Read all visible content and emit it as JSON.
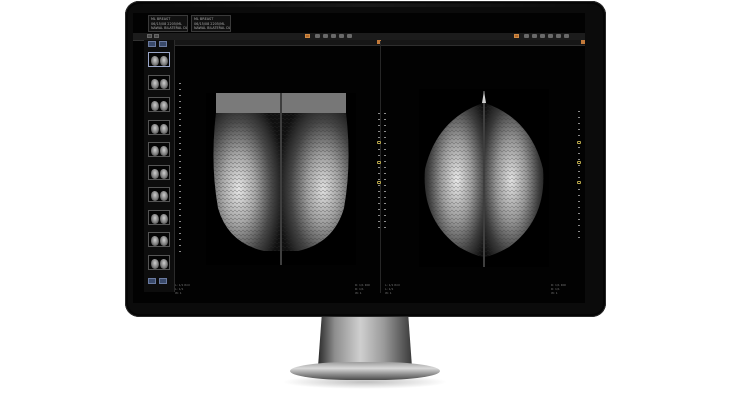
{
  "patient_info": {
    "left_box": [
      "ML BREAST",
      "06/15/08 2205/ML",
      "NAWAL BILATERAL DL"
    ],
    "right_box": [
      "ML BREAST",
      "06/15/08 2205/ML",
      "NAWAL BILATERAL DL"
    ]
  },
  "views": [
    {
      "id": "mlo",
      "name": "MLO pair"
    },
    {
      "id": "cc",
      "name": "CC pair"
    }
  ],
  "thumbnails": {
    "count": 10,
    "selected_index": 0
  },
  "status_text": {
    "left_bottom": [
      "L: 1/1 ROI",
      "L: 1/1",
      "W: 1"
    ],
    "mid_bottom": [
      "R: 1/1 ROI",
      "R: 1/1",
      "W: 1"
    ],
    "center_bottom": [
      "L: 1/1 ROI",
      "L: 1/1",
      "W: 1"
    ],
    "right_bottom": [
      "R: 1/1 ROI",
      "R: 1/1",
      "W: 1"
    ]
  },
  "colors": {
    "screen_bg": "#020202",
    "bezel": "#0b0b0b",
    "accent_orange": "#c37a3a",
    "ruler_marker": "#b8a64a",
    "nav_button": "#3a4a6a"
  }
}
